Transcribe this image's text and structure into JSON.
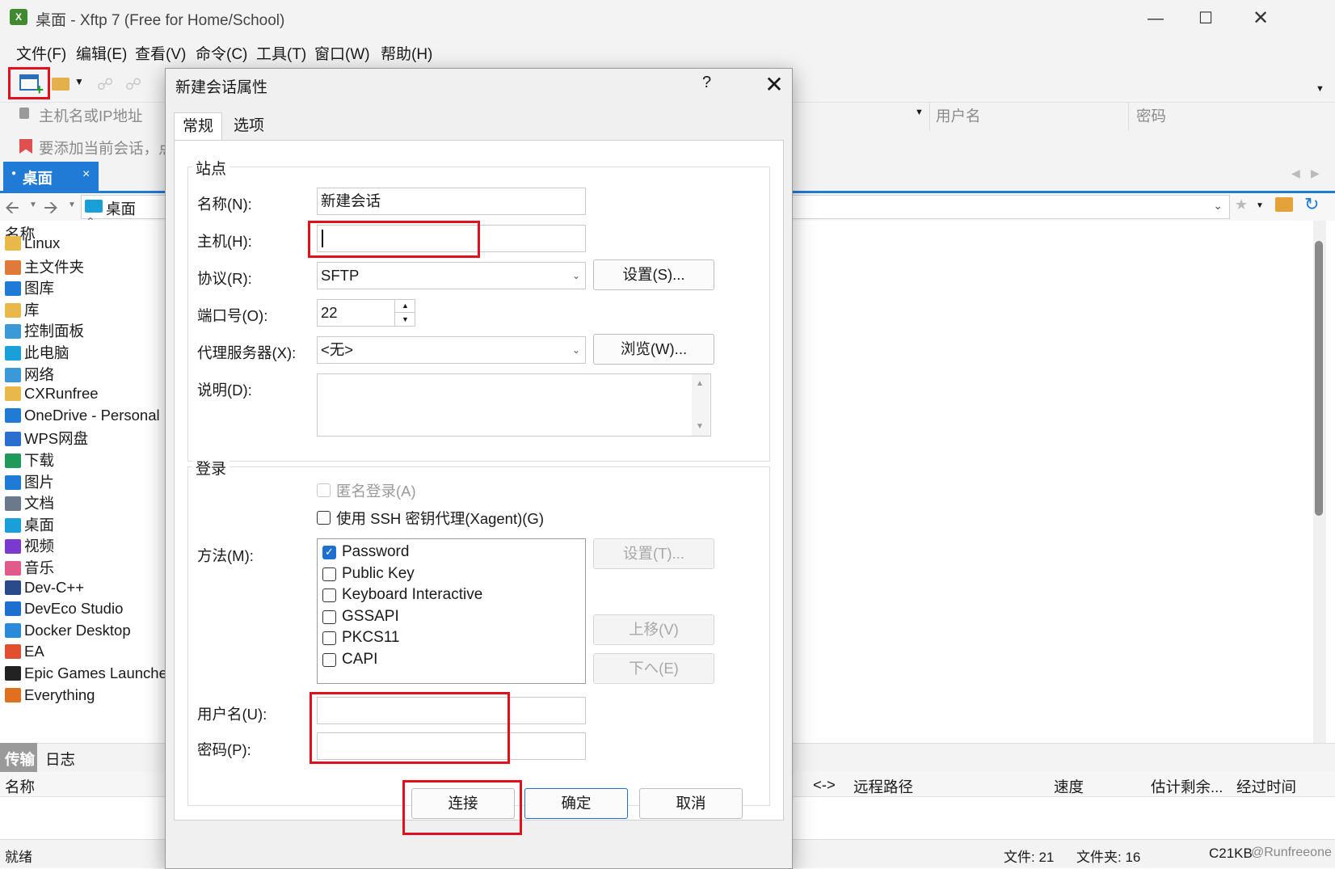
{
  "window": {
    "title": "桌面 - Xftp 7 (Free for Home/School)",
    "minimize_icon": "minimize-icon",
    "maximize_icon": "maximize-icon",
    "close_icon": "close-icon"
  },
  "menubar": [
    "文件(F)",
    "编辑(E)",
    "查看(V)",
    "命令(C)",
    "工具(T)",
    "窗口(W)",
    "帮助(H)"
  ],
  "addressbar": {
    "host_placeholder": "主机名或IP地址",
    "username_placeholder": "用户名",
    "password_placeholder": "密码"
  },
  "hint": "要添加当前会话，点",
  "tab": {
    "label": "桌面",
    "close": "×"
  },
  "nav": {
    "path": "桌面"
  },
  "left_panel": {
    "header": "名称",
    "items": [
      "Linux",
      "主文件夹",
      "图库",
      "库",
      "控制面板",
      "此电脑",
      "网络",
      "CXRunfree",
      "OneDrive - Personal",
      "WPS网盘",
      "下载",
      "图片",
      "文档",
      "桌面",
      "视频",
      "音乐",
      "Dev-C++",
      "DevEco Studio",
      "Docker Desktop",
      "EA",
      "Epic Games Launcher",
      "Everything"
    ]
  },
  "bottom_tabs": {
    "transfer": "传输",
    "log": "日志"
  },
  "transfer_columns": {
    "name": "名称",
    "direction": "<->",
    "remote_path": "远程路径",
    "speed": "速度",
    "eta": "估计剩余...",
    "elapsed": "经过时间"
  },
  "status": {
    "ready": "就绪",
    "files": "文件: 21",
    "folders": "文件夹: 16",
    "size": "C21KB",
    "watermark": "@Runfreeone"
  },
  "dialog": {
    "title": "新建会话属性",
    "help": "?",
    "close": "✕",
    "tabs": [
      "常规",
      "选项"
    ],
    "site_group": "站点",
    "name_label": "名称(N):",
    "name_value": "新建会话",
    "host_label": "主机(H):",
    "host_value": "",
    "protocol_label": "协议(R):",
    "protocol_value": "SFTP",
    "settings_button": "设置(S)...",
    "port_label": "端口号(O):",
    "port_value": "22",
    "proxy_label": "代理服务器(X):",
    "proxy_value": "<无>",
    "browse_button": "浏览(W)...",
    "description_label": "说明(D):",
    "login_group": "登录",
    "anonymous_label": "匿名登录(A)",
    "xagent_label": "使用 SSH 密钥代理(Xagent)(G)",
    "method_label": "方法(M):",
    "methods": [
      {
        "label": "Password",
        "checked": true
      },
      {
        "label": "Public Key",
        "checked": false
      },
      {
        "label": "Keyboard Interactive",
        "checked": false
      },
      {
        "label": "GSSAPI",
        "checked": false
      },
      {
        "label": "PKCS11",
        "checked": false
      },
      {
        "label": "CAPI",
        "checked": false
      }
    ],
    "method_settings_button": "设置(T)...",
    "move_up_button": "上移(V)",
    "move_down_button": "下へ(E)",
    "username_label": "用户名(U):",
    "password_label": "密码(P):",
    "connect_button": "连接",
    "ok_button": "确定",
    "cancel_button": "取消"
  },
  "colors": {
    "accent": "#1f7bd6",
    "highlight": "#e0101c",
    "checkbox": "#1f6fd0"
  }
}
